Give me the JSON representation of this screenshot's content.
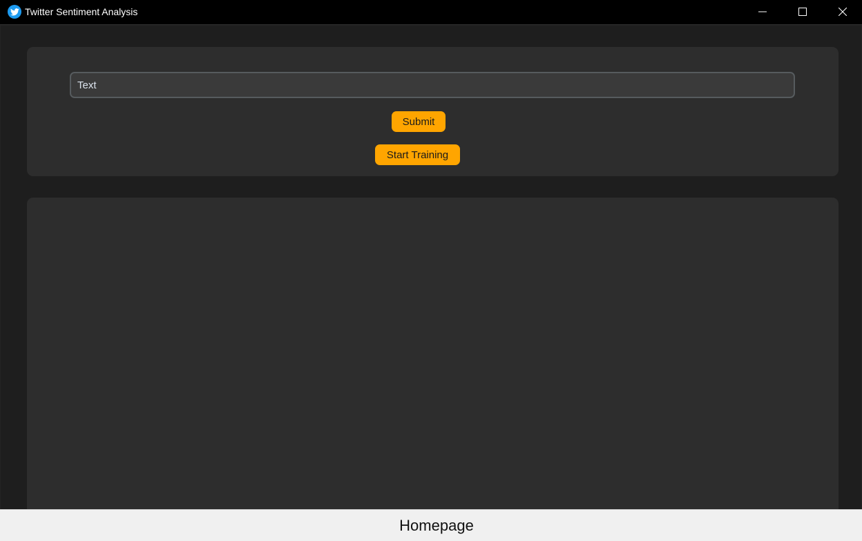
{
  "window": {
    "title": "Twitter Sentiment Analysis",
    "icon": "twitter-bird-icon"
  },
  "input": {
    "placeholder": "Text",
    "value": ""
  },
  "buttons": {
    "submit_label": "Submit",
    "train_label": "Start Training"
  },
  "footer": {
    "label": "Homepage"
  },
  "colors": {
    "accent": "#ffa500",
    "panel": "#2d2d2d",
    "background": "#1e1e1e",
    "titlebar": "#000000",
    "footer": "#f0f0f0"
  }
}
